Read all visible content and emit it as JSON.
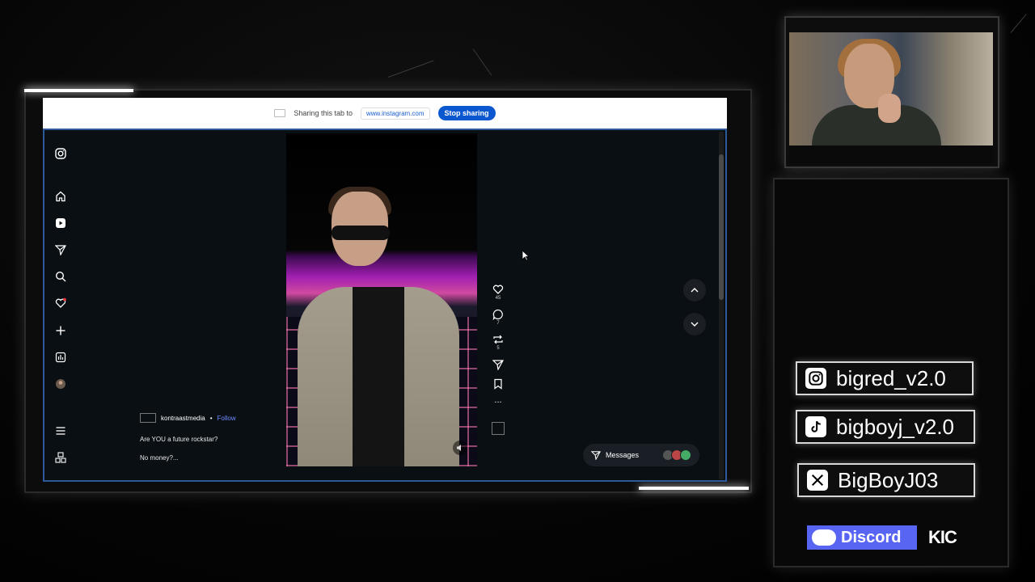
{
  "share_bar": {
    "text": "Sharing this tab to",
    "url": "www.instagram.com",
    "stop_label": "Stop sharing"
  },
  "post": {
    "username": "kontraastmedia",
    "separator": "•",
    "follow_label": "Follow",
    "caption_line1": "Are YOU a future rockstar?",
    "caption_line2": "No money?..."
  },
  "actions": {
    "likes": "45",
    "comments": "7",
    "reposts": "5",
    "more": "..."
  },
  "messages": {
    "label": "Messages"
  },
  "socials": {
    "instagram": "bigred_v2.0",
    "tiktok": "bigboyj_v2.0",
    "x": "BigBoyJ03",
    "discord": "Discord",
    "kick": "KIC"
  },
  "colors": {
    "accent_blue": "#0b57d0",
    "discord": "#5865f2",
    "follow": "#6f8cff"
  },
  "icons": [
    "instagram-icon",
    "home-icon",
    "reels-icon",
    "send-icon",
    "search-icon",
    "heart-icon",
    "plus-icon",
    "chart-icon",
    "profile-icon",
    "menu-icon",
    "meta-icon",
    "mute-icon",
    "chevron-up-icon",
    "chevron-down-icon",
    "bookmark-icon",
    "repost-icon",
    "comment-icon",
    "tiktok-icon",
    "x-icon"
  ]
}
